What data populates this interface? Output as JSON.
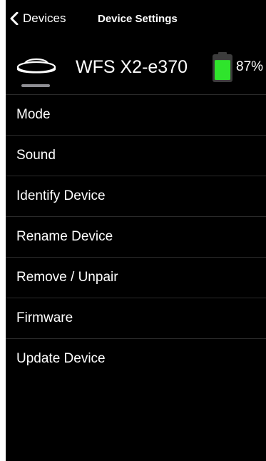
{
  "nav": {
    "back_label": "Devices",
    "title": "Device Settings"
  },
  "device": {
    "icon": "weight-scale-device-icon",
    "name": "WFS X2-e370",
    "battery_percent_label": "87%",
    "battery_level": 0.87,
    "battery_color": "#2fe42c"
  },
  "menu": {
    "items": [
      {
        "label": "Mode"
      },
      {
        "label": "Sound"
      },
      {
        "label": "Identify Device"
      },
      {
        "label": "Rename Device"
      },
      {
        "label": "Remove / Unpair"
      },
      {
        "label": "Firmware"
      },
      {
        "label": "Update Device"
      }
    ]
  }
}
